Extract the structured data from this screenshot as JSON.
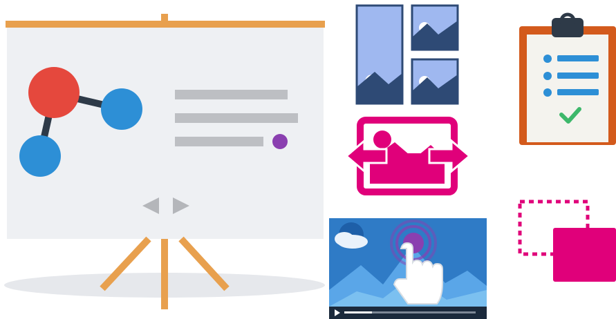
{
  "illustration": {
    "items": [
      {
        "name": "presentation-screen",
        "icon": "presentation-board-icon"
      },
      {
        "name": "image-gallery-layout",
        "icon": "image-gallery-icon"
      },
      {
        "name": "image-slider",
        "icon": "image-swap-icon"
      },
      {
        "name": "checklist-clipboard",
        "icon": "clipboard-checklist-icon"
      },
      {
        "name": "drag-move-box",
        "icon": "drag-drop-icon"
      },
      {
        "name": "interactive-video",
        "icon": "tap-video-icon"
      }
    ],
    "colors": {
      "orange": "#E8A04E",
      "red": "#E5483D",
      "blue": "#2D8FD6",
      "light_blue": "#9FB8F0",
      "magenta": "#E0007A",
      "purple": "#8A3FB0",
      "clipboard_brown": "#D35A1C",
      "check_green": "#3DB86B",
      "screen_gray": "#EEF0F3"
    }
  }
}
